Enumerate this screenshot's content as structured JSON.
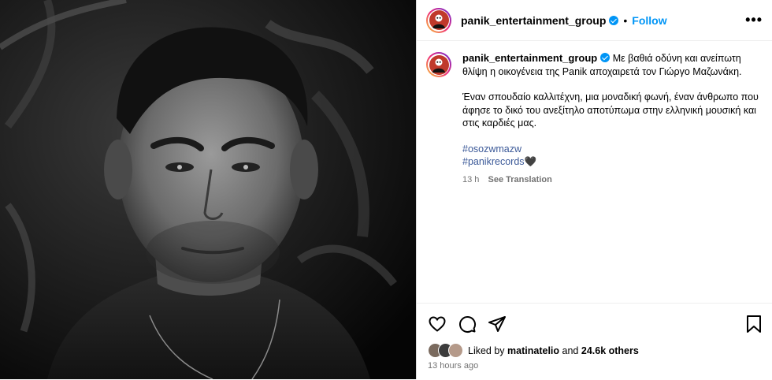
{
  "post": {
    "username": "panik_entertainment_group",
    "follow_label": "Follow",
    "separator": "•",
    "more_label": "•••"
  },
  "caption": {
    "username": "panik_entertainment_group",
    "line1": "Με βαθιά οδύνη και ανείπωτη θλίψη η οικογένεια της Panik αποχαιρετά τον Γιώργο Μαζωνάκη.",
    "line2": "Έναν σπουδαίο καλλιτέχνη, μια μοναδική φωνή, έναν άνθρωπο που άφησε το δικό του ανεξίτηλο αποτύπωμα στην ελληνική μουσική και στις καρδιές μας.",
    "tag1": "#osozwmazw",
    "tag2": "#panikrecords",
    "heart_emoji": "🖤",
    "time": "13 h",
    "see_translation": "See Translation"
  },
  "engagement": {
    "liked_by_prefix": "Liked by",
    "liked_by_user": "matinatelio",
    "and_label": "and",
    "others_count": "24.6k others",
    "posted_ago": "13 hours ago"
  },
  "colors": {
    "accent": "#0095f6",
    "hashtag": "#3b5998",
    "muted": "#737373"
  }
}
